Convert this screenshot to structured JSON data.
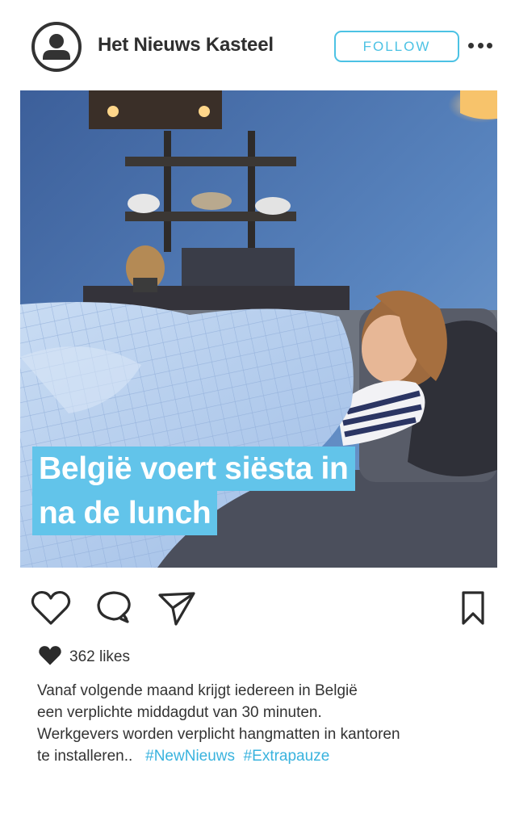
{
  "header": {
    "account_name": "Het Nieuws Kasteel",
    "follow_label": "FOLLOW",
    "more_icon": "more-horizontal-icon"
  },
  "post": {
    "headline": {
      "line1": "België voert siësta in",
      "line2": "na de lunch"
    },
    "likes": {
      "count_text": "362 likes",
      "icon": "heart-filled-icon"
    },
    "caption": {
      "line1": "Vanaf volgende maand krijgt iedereen in België",
      "line2": "een verplichte middagdut van 30 minuten.",
      "line3": "Werkgevers worden verplicht hangmatten in kantoren",
      "line4_text": "te installeren..",
      "hashtags": [
        "#NewNieuws",
        "#Extrapauze"
      ]
    }
  },
  "actions": {
    "like_icon": "heart-outline-icon",
    "comment_icon": "comment-icon",
    "share_icon": "send-icon",
    "save_icon": "bookmark-icon"
  },
  "colors": {
    "accent": "#4cc2e4",
    "headline_bg": "#62c4ea",
    "hashtag": "#39b3de",
    "text": "#333333"
  }
}
